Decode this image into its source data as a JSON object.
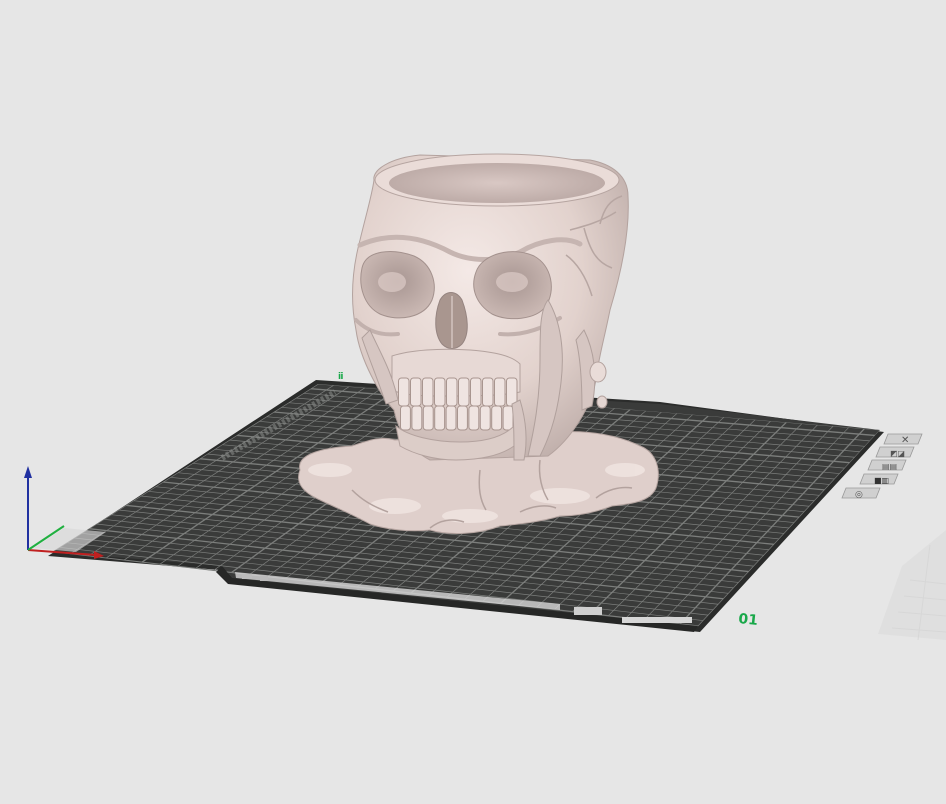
{
  "viewport": {
    "background": "#e6e6e6"
  },
  "build_plate": {
    "plate_number": "01",
    "plate_color": "#3a3b3a",
    "grid_color": "#7c7e7c",
    "edge_color": "#2a2a2a"
  },
  "model": {
    "name": "skull-planter",
    "color": "#e5d6d2"
  },
  "axes": {
    "x_color": "#c02020",
    "y_color": "#20b040",
    "z_color": "#2030a0"
  },
  "plate_controls": {
    "icons": [
      "close-icon",
      "orient-icon",
      "arrange-icon",
      "lock-icon",
      "settings-icon"
    ]
  }
}
